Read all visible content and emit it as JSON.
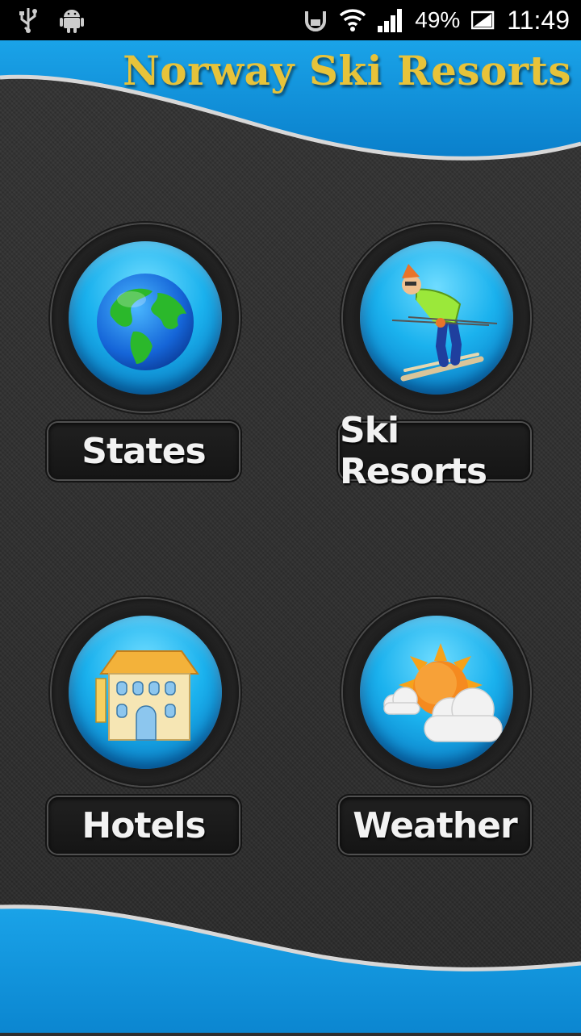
{
  "status_bar": {
    "icons_left": [
      "usb-icon",
      "android-icon"
    ],
    "icons_right": [
      "nfc-icon",
      "wifi-icon",
      "signal-icon"
    ],
    "battery": "49%",
    "time": "11:49"
  },
  "header": {
    "title": "Norway Ski Resorts",
    "title_color": "#e7c33a",
    "accent": "#0e93da"
  },
  "menu": {
    "states": {
      "label": "States",
      "icon": "globe-icon"
    },
    "ski_resorts": {
      "label": "Ski Resorts",
      "icon": "skier-icon"
    },
    "hotels": {
      "label": "Hotels",
      "icon": "hotel-icon"
    },
    "weather": {
      "label": "Weather",
      "icon": "weather-icon"
    }
  }
}
